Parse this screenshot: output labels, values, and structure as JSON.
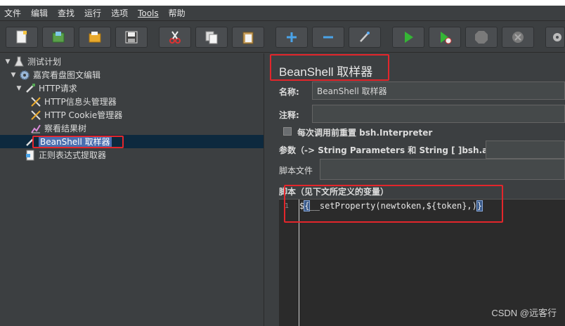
{
  "menu": [
    "文件",
    "编辑",
    "查找",
    "运行",
    "选项",
    "Tools",
    "帮助"
  ],
  "tree": {
    "test_plan": "测试计划",
    "thread_group": "嘉宾看盘图文编辑",
    "http_request": "HTTP请求",
    "header_manager": "HTTP信息头管理器",
    "cookie_manager": "HTTP Cookie管理器",
    "result_tree": "察看结果树",
    "beanshell": "BeanShell 取样器",
    "regex_extractor": "正则表达式提取器"
  },
  "panel": {
    "title": "BeanShell 取样器",
    "name_label": "名称:",
    "name_value": "BeanShell 取样器",
    "comment_label": "注释:",
    "comment_value": "",
    "reset_label": "每次调用前重置 bsh.Interpreter",
    "params_label": "参数（-> String Parameters 和 String [ ]bsh.args）",
    "script_file_label": "脚本文件",
    "script_label": "脚本（见下文所定义的变量）",
    "line_number": "1",
    "code_prefix": "$",
    "code_open": "{",
    "code_body": "__setProperty(newtoken,${token},)",
    "code_close": "}"
  },
  "watermark": "CSDN @远客行",
  "colors": {
    "background": "#3c3f41",
    "selection": "#4b6eaf",
    "highlight_box": "#e3262b"
  }
}
